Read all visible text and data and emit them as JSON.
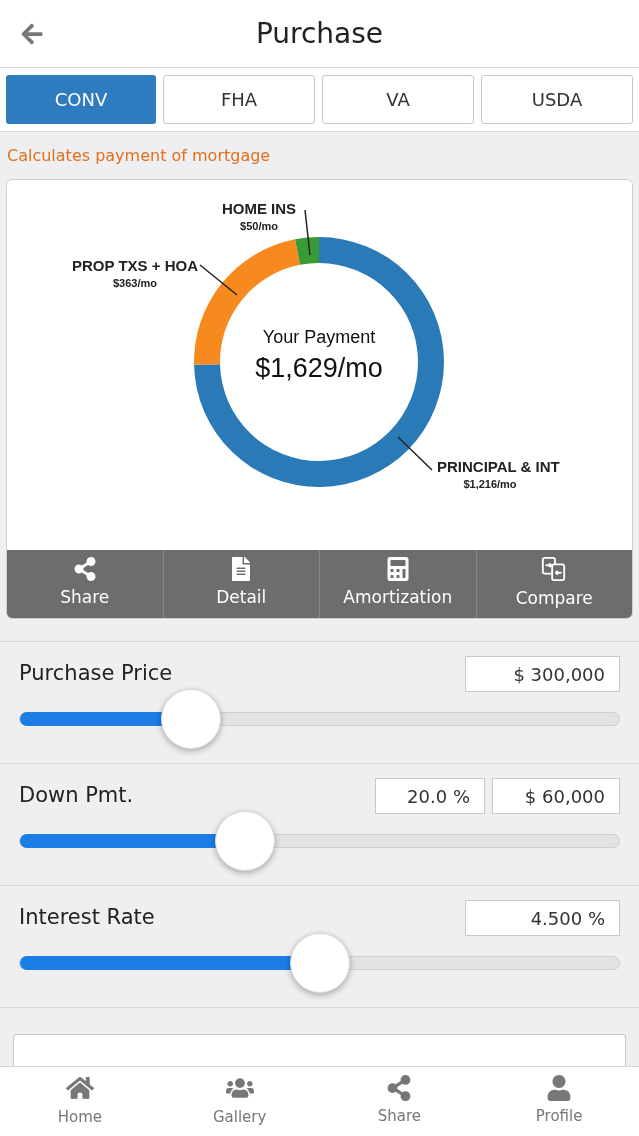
{
  "header": {
    "title": "Purchase"
  },
  "tabs": [
    {
      "label": "CONV",
      "selected": true
    },
    {
      "label": "FHA",
      "selected": false
    },
    {
      "label": "VA",
      "selected": false
    },
    {
      "label": "USDA",
      "selected": false
    }
  ],
  "subtitle": "Calculates payment of mortgage",
  "payment_card": {
    "center_label": "Your Payment",
    "center_value": "$1,629/mo",
    "chart_data": {
      "type": "donut",
      "categories": [
        "PRINCIPAL & INT",
        "PROP TXS + HOA",
        "HOME INS"
      ],
      "values": [
        1216,
        363,
        50
      ],
      "colors": [
        "#2a7ab8",
        "#f68a1e",
        "#3a9a35"
      ],
      "value_labels": [
        "$1,216/mo",
        "$363/mo",
        "$50/mo"
      ]
    },
    "actions": [
      {
        "kind": "share",
        "label": "Share"
      },
      {
        "kind": "detail",
        "label": "Detail"
      },
      {
        "kind": "amortization",
        "label": "Amortization"
      },
      {
        "kind": "compare",
        "label": "Compare"
      }
    ]
  },
  "inputs": [
    {
      "label": "Purchase Price",
      "fields": [
        "$ 300,000"
      ],
      "level": 0.286
    },
    {
      "label": "Down Pmt.",
      "fields": [
        "20.0 %",
        "$ 60,000"
      ],
      "level": 0.376
    },
    {
      "label": "Interest Rate",
      "fields": [
        "4.500 %"
      ],
      "level": 0.5
    }
  ],
  "bottom_nav": [
    {
      "kind": "home",
      "label": "Home"
    },
    {
      "kind": "gallery",
      "label": "Gallery"
    },
    {
      "kind": "share",
      "label": "Share"
    },
    {
      "kind": "profile",
      "label": "Profile"
    }
  ]
}
